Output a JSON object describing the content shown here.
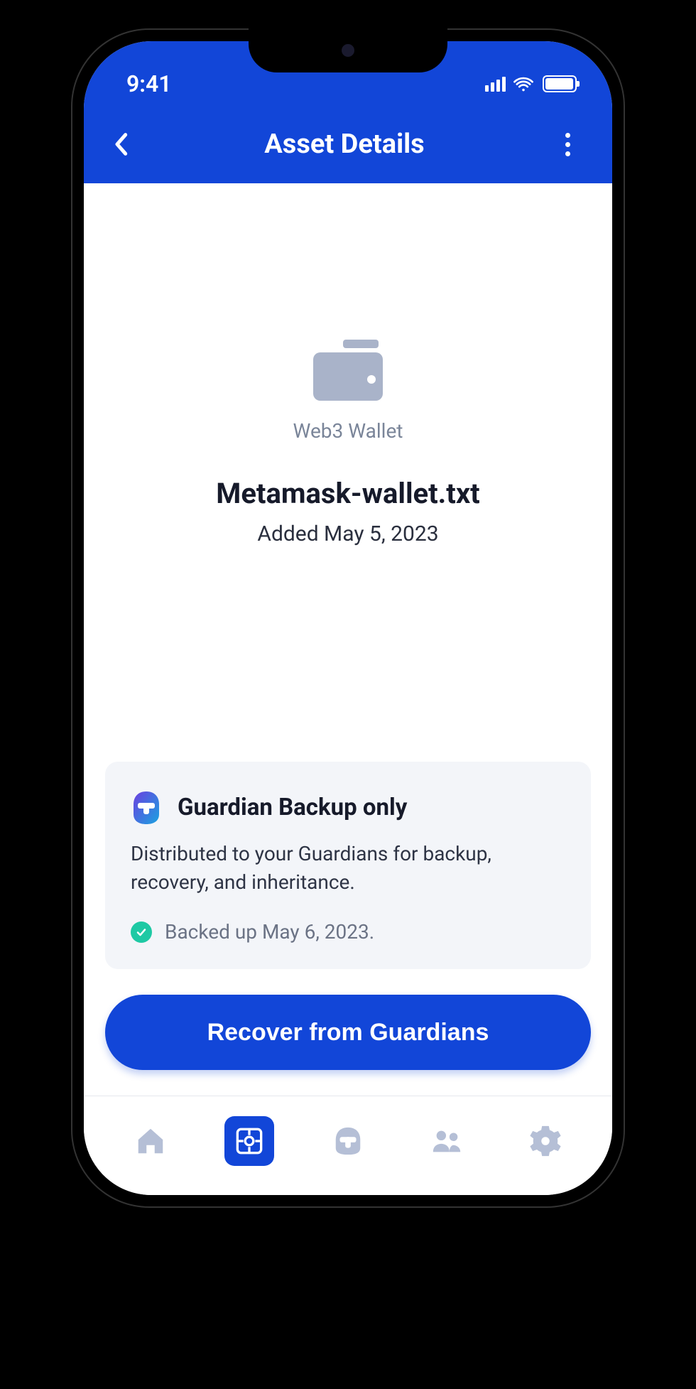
{
  "status_bar": {
    "time": "9:41"
  },
  "header": {
    "title": "Asset Details"
  },
  "asset": {
    "type_label": "Web3 Wallet",
    "filename": "Metamask-wallet.txt",
    "added_line": "Added May 5, 2023"
  },
  "backup_card": {
    "title": "Guardian Backup only",
    "description": "Distributed to your Guardians for backup, recovery, and inheritance.",
    "status_text": "Backed up May 6, 2023."
  },
  "actions": {
    "recover_label": "Recover from Guardians"
  }
}
